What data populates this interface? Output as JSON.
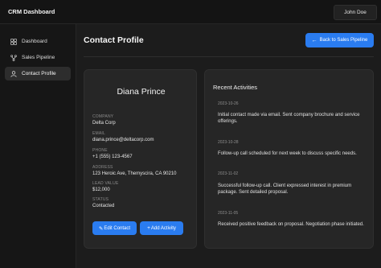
{
  "app": {
    "title": "CRM Dashboard",
    "user": "John Doe"
  },
  "sidebar": {
    "items": [
      {
        "label": "Dashboard",
        "icon": "dashboard-icon",
        "active": false
      },
      {
        "label": "Sales Pipeline",
        "icon": "pipeline-icon",
        "active": false
      },
      {
        "label": "Contact Profile",
        "icon": "user-icon",
        "active": true
      }
    ]
  },
  "page": {
    "title": "Contact Profile",
    "back_button": "Back to Sales Pipeline"
  },
  "contact": {
    "name": "Diana Prince",
    "fields": [
      {
        "label": "COMPANY",
        "value": "Delta Corp"
      },
      {
        "label": "EMAIL",
        "value": "diana.prince@deltacorp.com"
      },
      {
        "label": "PHONE",
        "value": "+1 (555) 123-4567"
      },
      {
        "label": "ADDRESS",
        "value": "123 Heroic Ave, Themyscira, CA 90210"
      },
      {
        "label": "LEAD VALUE",
        "value": "$12,000"
      },
      {
        "label": "STATUS",
        "value": "Contacted"
      }
    ],
    "edit_button": "Edit Contact",
    "add_button": "Add Activity"
  },
  "activities": {
    "title": "Recent Activities",
    "items": [
      {
        "date": "2023-10-26",
        "text": "Initial contact made via email. Sent company brochure and service offerings."
      },
      {
        "date": "2023-10-28",
        "text": "Follow-up call scheduled for next week to discuss specific needs."
      },
      {
        "date": "2023-11-02",
        "text": "Successful follow-up call. Client expressed interest in premium package. Sent detailed proposal."
      },
      {
        "date": "2023-11-05",
        "text": "Received positive feedback on proposal. Negotiation phase initiated."
      }
    ]
  },
  "colors": {
    "accent": "#2a7cf0",
    "background": "#1c1c1c",
    "card": "#262626",
    "sidebar": "#161616"
  }
}
